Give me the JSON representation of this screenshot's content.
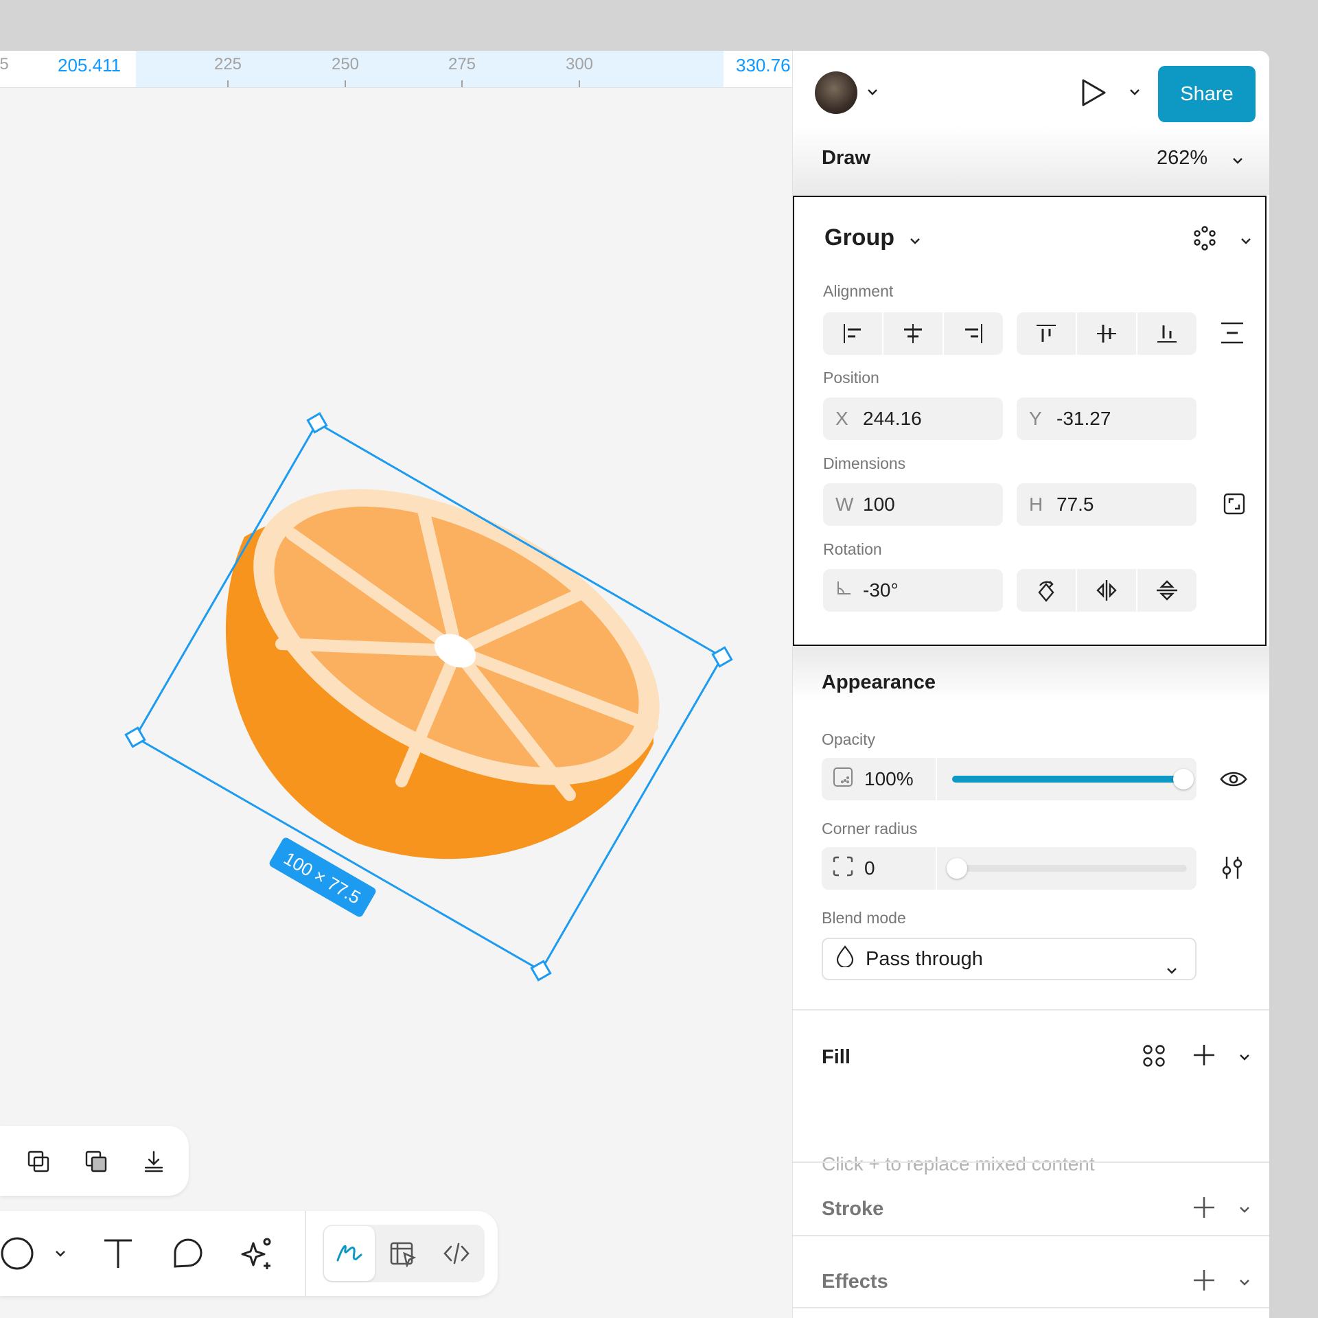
{
  "ruler": {
    "left_edge_value": "205.411",
    "right_edge_value": "330.76",
    "ticks": [
      "225",
      "250",
      "275",
      "300"
    ],
    "partial_left": "5"
  },
  "canvas": {
    "selection_size_badge": "100 × 77.5",
    "selection_color": "#1d9bf0",
    "orange_colors": {
      "peel": "#f7941d",
      "rind": "#fde1bf",
      "flesh": "#fbb05f"
    }
  },
  "header": {
    "share_label": "Share",
    "mode": "Draw",
    "zoom": "262%",
    "accent_color": "#0d99c4"
  },
  "group": {
    "title": "Group",
    "alignment_label": "Alignment",
    "position_label": "Position",
    "x_prefix": "X",
    "x_value": "244.16",
    "y_prefix": "Y",
    "y_value": "-31.27",
    "dimensions_label": "Dimensions",
    "w_prefix": "W",
    "w_value": "100",
    "h_prefix": "H",
    "h_value": "77.5",
    "rotation_label": "Rotation",
    "rotation_value": "-30°"
  },
  "appearance": {
    "title": "Appearance",
    "opacity_label": "Opacity",
    "opacity_value": "100%",
    "opacity_level": 1.0,
    "corner_radius_label": "Corner radius",
    "corner_radius_value": "0",
    "corner_radius_level": 0,
    "blend_mode_label": "Blend mode",
    "blend_mode_value": "Pass through"
  },
  "fill": {
    "title": "Fill",
    "placeholder": "Click + to replace mixed content"
  },
  "stroke": {
    "title": "Stroke"
  },
  "effects": {
    "title": "Effects"
  }
}
